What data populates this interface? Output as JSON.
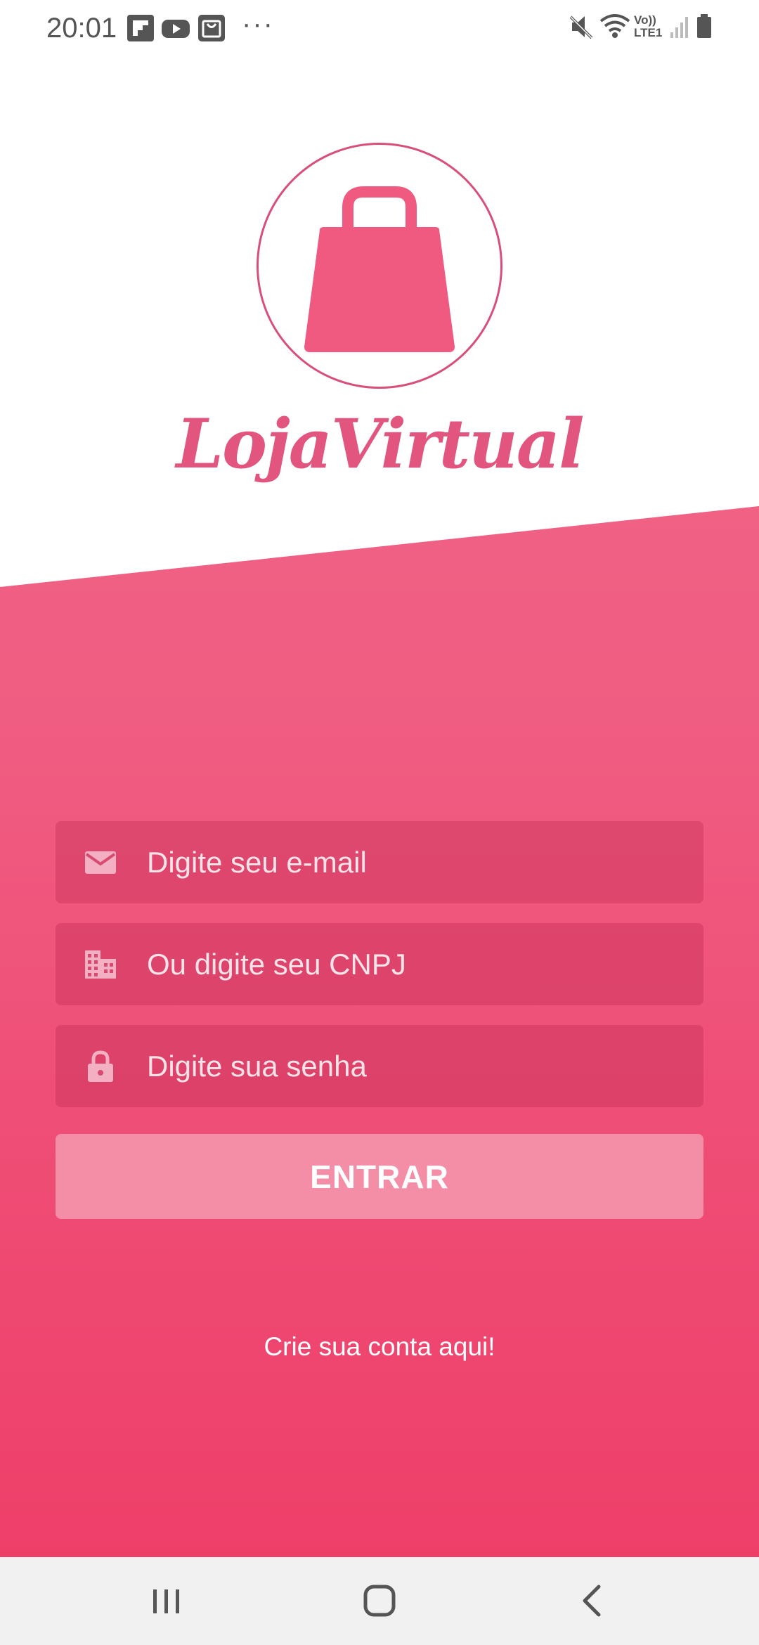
{
  "status_bar": {
    "time": "20:01",
    "app_icons": [
      "flipboard-icon",
      "youtube-icon",
      "shopping-bag-icon"
    ],
    "more": "···",
    "right_icons": [
      "mute-icon",
      "wifi-icon",
      "volte-icon",
      "signal-icon",
      "battery-icon"
    ],
    "volte_top": "Vo))",
    "volte_bottom": "LTE1"
  },
  "logo": {
    "title": "LojaVirtual",
    "icon": "shopping-bag-icon"
  },
  "form": {
    "email_placeholder": "Digite seu e-mail",
    "cnpj_placeholder": "Ou digite seu CNPJ",
    "password_placeholder": "Digite sua senha",
    "email_icon": "mail-icon",
    "cnpj_icon": "building-icon",
    "password_icon": "lock-icon",
    "submit_label": "ENTRAR"
  },
  "signup_link": "Crie sua conta aqui!",
  "nav_bar": {
    "buttons": [
      "recent-apps-icon",
      "home-icon",
      "back-icon"
    ]
  },
  "colors": {
    "brand": "#f05a80",
    "logo_text": "#e2557f",
    "button": "#f48ea7"
  }
}
